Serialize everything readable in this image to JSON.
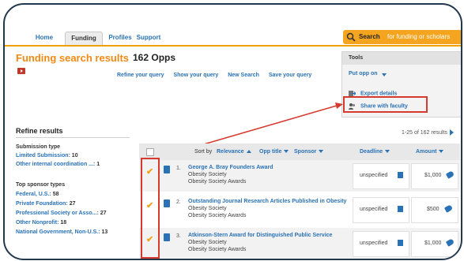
{
  "nav": {
    "tabs": [
      {
        "label": "Home"
      },
      {
        "label": "Funding"
      },
      {
        "label": "Profiles"
      },
      {
        "label": "Support"
      }
    ],
    "search_label": "Search",
    "search_hint": "for funding or scholars"
  },
  "page": {
    "title": "Funding search results",
    "count": "162 Opps",
    "query_links": [
      "Refine your query",
      "Show your query",
      "New Search",
      "Save your query"
    ]
  },
  "tools": {
    "heading": "Tools",
    "put_opp_on": "Put opp on",
    "export": "Export details",
    "share": "Share with faculty"
  },
  "refine": {
    "heading": "Refine results",
    "submission_type": {
      "title": "Submission type",
      "items": [
        {
          "label": "Limited Submission:",
          "count": "10"
        },
        {
          "label": "Other internal coordination ...:",
          "count": "1"
        }
      ]
    },
    "sponsor_types": {
      "title": "Top sponsor types",
      "items": [
        {
          "label": "Federal, U.S.:",
          "count": "58"
        },
        {
          "label": "Private Foundation:",
          "count": "27"
        },
        {
          "label": "Professional Society or Asso...:",
          "count": "27"
        },
        {
          "label": "Other Nonprofit:",
          "count": "18"
        },
        {
          "label": "National Government, Non-U.S.:",
          "count": "13"
        }
      ]
    }
  },
  "results": {
    "range": "1-25 of 162 results",
    "sort_by": "Sort by",
    "columns": {
      "relevance": "Relevance",
      "opp_title": "Opp title",
      "sponsor": "Sponsor",
      "deadline": "Deadline",
      "amount": "Amount"
    },
    "rows": [
      {
        "num": "1.",
        "title": "George A. Bray Founders Award",
        "sponsor": "Obesity Society",
        "program": "Obesity Society Awards",
        "deadline": "unspecified",
        "amount": "$1,000"
      },
      {
        "num": "2.",
        "title": "Outstanding Journal Research Articles Published in Obesity",
        "sponsor": "Obesity Society",
        "program": "Obesity Society Awards",
        "deadline": "unspecified",
        "amount": "$500"
      },
      {
        "num": "3.",
        "title": "Atkinson-Stern Award for Distinguished Public Service",
        "sponsor": "Obesity Society",
        "program": "Obesity Society Awards",
        "deadline": "unspecified",
        "amount": "$1,000"
      }
    ]
  },
  "colors": {
    "accent": "#f08a14",
    "link": "#2a72b6",
    "highlight": "#d63a2f",
    "nav_bar": "#f0a000"
  }
}
